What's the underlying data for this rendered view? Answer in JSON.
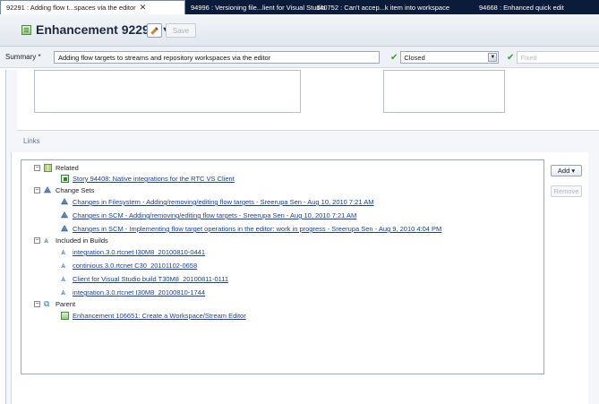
{
  "tabs": [
    {
      "label": "92291 : Adding flow t...spaces via the editor",
      "active": true
    },
    {
      "label": "94996 : Versioning file...lient for Visual Studio",
      "active": false
    },
    {
      "label": "140752 : Can't accep...k item into workspace",
      "active": false
    },
    {
      "label": "94668 : Enhanced quick edit",
      "active": false
    }
  ],
  "header": {
    "title": "Enhancement 92291",
    "title_caret": "▾",
    "save_label": "Save",
    "edit_icon": "pencil-icon"
  },
  "summary": {
    "label": "Summary *",
    "value": "Adding flow targets to streams and repository workspaces via the editor",
    "status": "Closed",
    "resolution": "Fixed"
  },
  "links": {
    "section_label": "Links",
    "add_label": "Add ▾",
    "remove_label": "Remove",
    "groups": {
      "related": {
        "label": "Related",
        "items": [
          "Story 94408: Native integrations for the RTC VS Client"
        ]
      },
      "change_sets": {
        "label": "Change Sets",
        "items": [
          "Changes in Filesystem - Adding/removing/editing flow targets - Sreerupa Sen - Aug 10, 2010 7:21 AM",
          "Changes in SCM - Adding/removing/editing flow targets - Sreerupa Sen - Aug 10, 2010 7:21 AM",
          "Changes in SCM - Implementing flow target operations in the editor: work in progress - Sreerupa Sen - Aug 9, 2010 4:04 PM"
        ]
      },
      "builds": {
        "label": "Included in Builds",
        "items": [
          "integration.3.0.rtcnet I30M8_20100810-0441",
          "continious.3.0.rtcnet C30_20101102-0658",
          "Client for Visual Studio build T30M8_20100811-0111",
          "integration.3.0.rtcnet I30M8_20100810-1744"
        ]
      },
      "parent": {
        "label": "Parent",
        "items": [
          "Enhancement 106651: Create a Workspace/Stream Editor"
        ]
      }
    }
  },
  "colors": {
    "tab_bar": "#0a1c3a",
    "link": "#1a3f9e",
    "section_label": "#5a78a6",
    "check": "#33a02c"
  }
}
